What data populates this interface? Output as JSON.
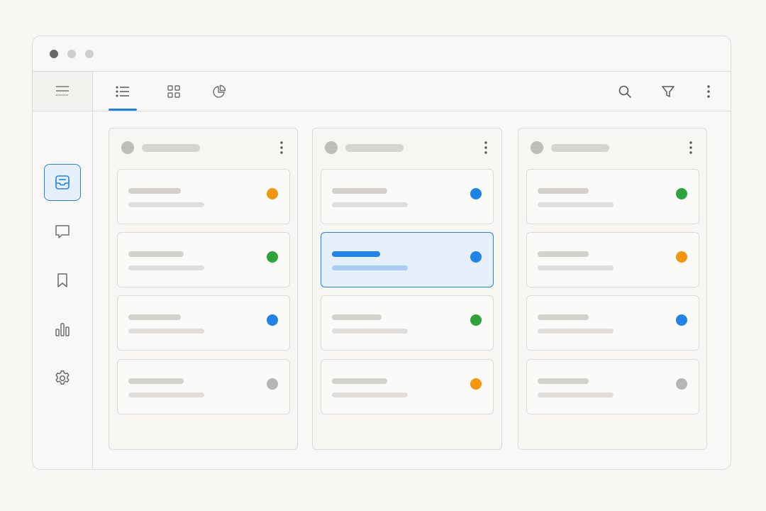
{
  "window": {
    "controls": [
      {
        "name": "close",
        "color": "#6b6966"
      },
      {
        "name": "minimize",
        "color": "#d0cecb"
      },
      {
        "name": "maximize",
        "color": "#d0cecb"
      }
    ]
  },
  "sidebar": {
    "menu_icon": "hamburger-icon",
    "items": [
      {
        "name": "inbox",
        "icon": "inbox-tray-icon",
        "active": true
      },
      {
        "name": "messages",
        "icon": "chat-bubble-icon",
        "active": false
      },
      {
        "name": "bookmarks",
        "icon": "bookmark-icon",
        "active": false
      },
      {
        "name": "analytics",
        "icon": "bar-chart-icon",
        "active": false
      },
      {
        "name": "settings",
        "icon": "gear-icon",
        "active": false
      }
    ]
  },
  "toolbar": {
    "view_tabs": [
      {
        "name": "list-view",
        "icon": "list-icon",
        "active": true
      },
      {
        "name": "grid-view",
        "icon": "grid-icon",
        "active": false
      },
      {
        "name": "chart-view",
        "icon": "pie-chart-icon",
        "active": false
      }
    ],
    "actions": [
      {
        "name": "search",
        "icon": "search-icon"
      },
      {
        "name": "filter",
        "icon": "filter-icon"
      },
      {
        "name": "more",
        "icon": "vertical-dots-icon"
      }
    ]
  },
  "board": {
    "columns": [
      {
        "cards": [
          {
            "status_color": "#f2950f",
            "selected": false
          },
          {
            "status_color": "#2ea33a",
            "selected": false
          },
          {
            "status_color": "#1f83e8",
            "selected": false
          },
          {
            "status_color": "#b8b6b2",
            "selected": false
          }
        ]
      },
      {
        "cards": [
          {
            "status_color": "#1f83e8",
            "selected": false
          },
          {
            "status_color": "#1f83e8",
            "selected": true
          },
          {
            "status_color": "#2ea33a",
            "selected": false
          },
          {
            "status_color": "#f2950f",
            "selected": false
          }
        ]
      },
      {
        "cards": [
          {
            "status_color": "#2ea33a",
            "selected": false
          },
          {
            "status_color": "#f2950f",
            "selected": false
          },
          {
            "status_color": "#1f83e8",
            "selected": false
          },
          {
            "status_color": "#b8b6b2",
            "selected": false
          }
        ]
      }
    ]
  },
  "colors": {
    "accent": "#1f83e8",
    "border": "#dcdad6",
    "placeholder": "#d3d1cc"
  }
}
